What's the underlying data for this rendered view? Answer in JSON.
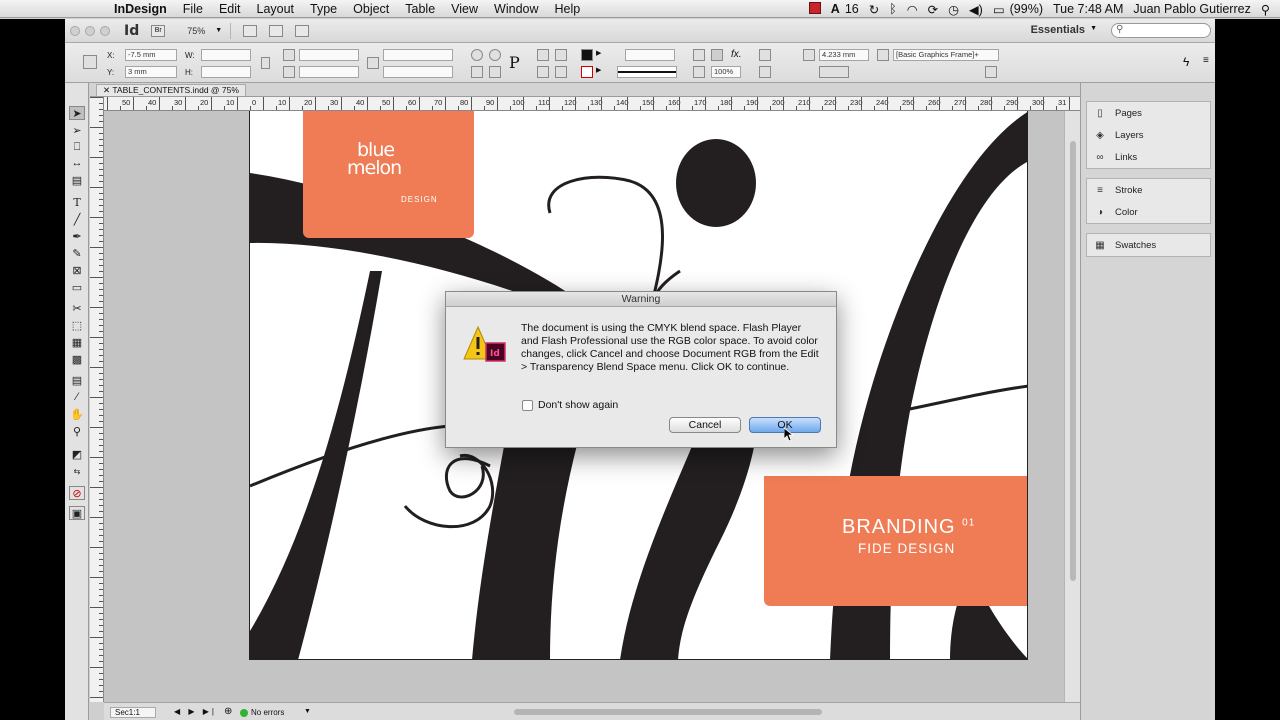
{
  "menubar": {
    "app_name": "InDesign",
    "menus": [
      "File",
      "Edit",
      "Layout",
      "Type",
      "Object",
      "Table",
      "View",
      "Window",
      "Help"
    ],
    "status": {
      "adobe_count": "16",
      "battery": "(99%)",
      "clock": "Tue 7:48 AM",
      "user": "Juan Pablo Gutierrez"
    }
  },
  "appbar": {
    "logo": "Id",
    "bridge": "Br",
    "zoom": "75%",
    "workspace": "Essentials",
    "search_placeholder": ""
  },
  "control": {
    "x_label": "X:",
    "x_value": "-7.5 mm",
    "y_label": "Y:",
    "y_value": "3 mm",
    "w_label": "W:",
    "h_label": "H:",
    "opacity": "100%",
    "stroke_weight": "4.233 mm",
    "object_style": "[Basic Graphics Frame]+"
  },
  "document": {
    "tab_title": "TABLE_CONTENTS.indd @ 75%",
    "ruler_ticks": [
      "0",
      "10",
      "20",
      "30",
      "40",
      "50",
      "60",
      "70",
      "80",
      "90",
      "100",
      "110",
      "120",
      "130",
      "140",
      "150",
      "160",
      "170",
      "180",
      "190",
      "200",
      "210",
      "220",
      "230",
      "240",
      "250",
      "260",
      "270",
      "280",
      "290",
      "300",
      "31"
    ],
    "ruler_ticks_neg": [
      "50",
      "40",
      "30",
      "20",
      "10"
    ],
    "logo_text_line1": "blue",
    "logo_text_line2": "melon",
    "logo_sub": "DESIGN",
    "branding_title": "BRANDING",
    "branding_num": "01",
    "branding_sub": "FIDE DESIGN"
  },
  "dialog": {
    "title": "Warning",
    "message": "The document is using the CMYK blend space. Flash Player and Flash Professional use the RGB color space. To avoid color changes, click Cancel and choose Document RGB from the Edit > Transparency Blend Space menu. Click OK to continue.",
    "checkbox_label": "Don't show again",
    "cancel_label": "Cancel",
    "ok_label": "OK"
  },
  "statusbar": {
    "page": "Sec1:1",
    "errors": "No errors"
  },
  "panels": {
    "group1": [
      "Pages",
      "Layers",
      "Links"
    ],
    "group2": [
      "Stroke",
      "Color"
    ],
    "group3": [
      "Swatches"
    ]
  },
  "colors": {
    "brand_orange": "#ef7c55",
    "ink": "#231f20",
    "ok_blue": "#6fa8ee",
    "status_green": "#34b233"
  }
}
